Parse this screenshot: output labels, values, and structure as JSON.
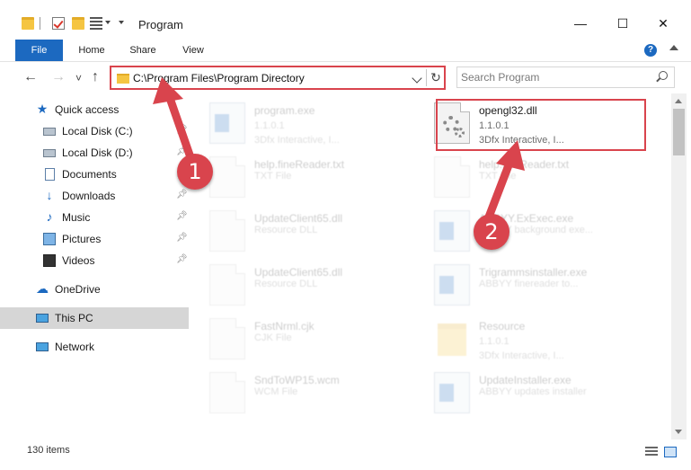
{
  "window": {
    "title": "Program",
    "minimize": "—",
    "maximize": "☐",
    "close": "✕"
  },
  "ribbon": {
    "tabs": [
      {
        "label": "File"
      },
      {
        "label": "Home"
      },
      {
        "label": "Share"
      },
      {
        "label": "View"
      }
    ],
    "help": "?"
  },
  "nav": {
    "back": "←",
    "forward": "→",
    "recent": "˅",
    "up": "↑",
    "address": "C:\\Program Files\\Program Directory",
    "refresh": "↻",
    "search_placeholder": "Search Program"
  },
  "sidebar": {
    "items": [
      {
        "label": "Quick access",
        "icon": "star-icon"
      },
      {
        "label": "Local Disk (C:)",
        "icon": "disk-icon"
      },
      {
        "label": "Local Disk (D:)",
        "icon": "disk-icon"
      },
      {
        "label": "Documents",
        "icon": "documents-icon"
      },
      {
        "label": "Downloads",
        "icon": "downloads-icon"
      },
      {
        "label": "Music",
        "icon": "music-icon"
      },
      {
        "label": "Pictures",
        "icon": "pictures-icon"
      },
      {
        "label": "Videos",
        "icon": "videos-icon"
      },
      {
        "label": "OneDrive",
        "icon": "cloud-icon"
      },
      {
        "label": "This PC",
        "icon": "computer-icon"
      },
      {
        "label": "Network",
        "icon": "network-icon"
      }
    ]
  },
  "files": [
    {
      "name": "program.exe",
      "line2": "1.1.0.1",
      "line3": "3Dfx Interactive, I...",
      "icon": "exe"
    },
    {
      "name": "opengl32.dll",
      "line2": "1.1.0.1",
      "line3": "3Dfx Interactive, I...",
      "icon": "dll"
    },
    {
      "name": "help.fineReader.txt",
      "line2": "TXT File",
      "line3": "",
      "icon": "doc"
    },
    {
      "name": "help.fineReader.txt",
      "line2": "TXT File",
      "line3": "",
      "icon": "doc"
    },
    {
      "name": "UpdateClient65.dll",
      "line2": "Resource DLL",
      "line3": "",
      "icon": "dll"
    },
    {
      "name": "ABBYY.ExExec.exe",
      "line2": "ABBYY background exe...",
      "line3": "",
      "icon": "exe"
    },
    {
      "name": "UpdateClient65.dll",
      "line2": "Resource DLL",
      "line3": "",
      "icon": "dll"
    },
    {
      "name": "Trigrammsinstaller.exe",
      "line2": "ABBYY finereader to...",
      "line3": "",
      "icon": "exe"
    },
    {
      "name": "FastNrml.cjk",
      "line2": "CJK File",
      "line3": "",
      "icon": "doc"
    },
    {
      "name": "Resource",
      "line2": "1.1.0.1",
      "line3": "3Dfx Interactive, I...",
      "icon": "folder"
    },
    {
      "name": "SndToWP15.wcm",
      "line2": "WCM File",
      "line3": "",
      "icon": "doc"
    },
    {
      "name": "UpdateInstaller.exe",
      "line2": "ABBYY updates installer",
      "line3": "",
      "icon": "exe"
    }
  ],
  "annotations": {
    "marker1": "1",
    "marker2": "2",
    "color": "#d9444d"
  },
  "status": {
    "items_count": "130 items"
  },
  "colors": {
    "accent": "#1c69c0",
    "highlight": "#d9444d",
    "selection": "#d6d6d6"
  }
}
